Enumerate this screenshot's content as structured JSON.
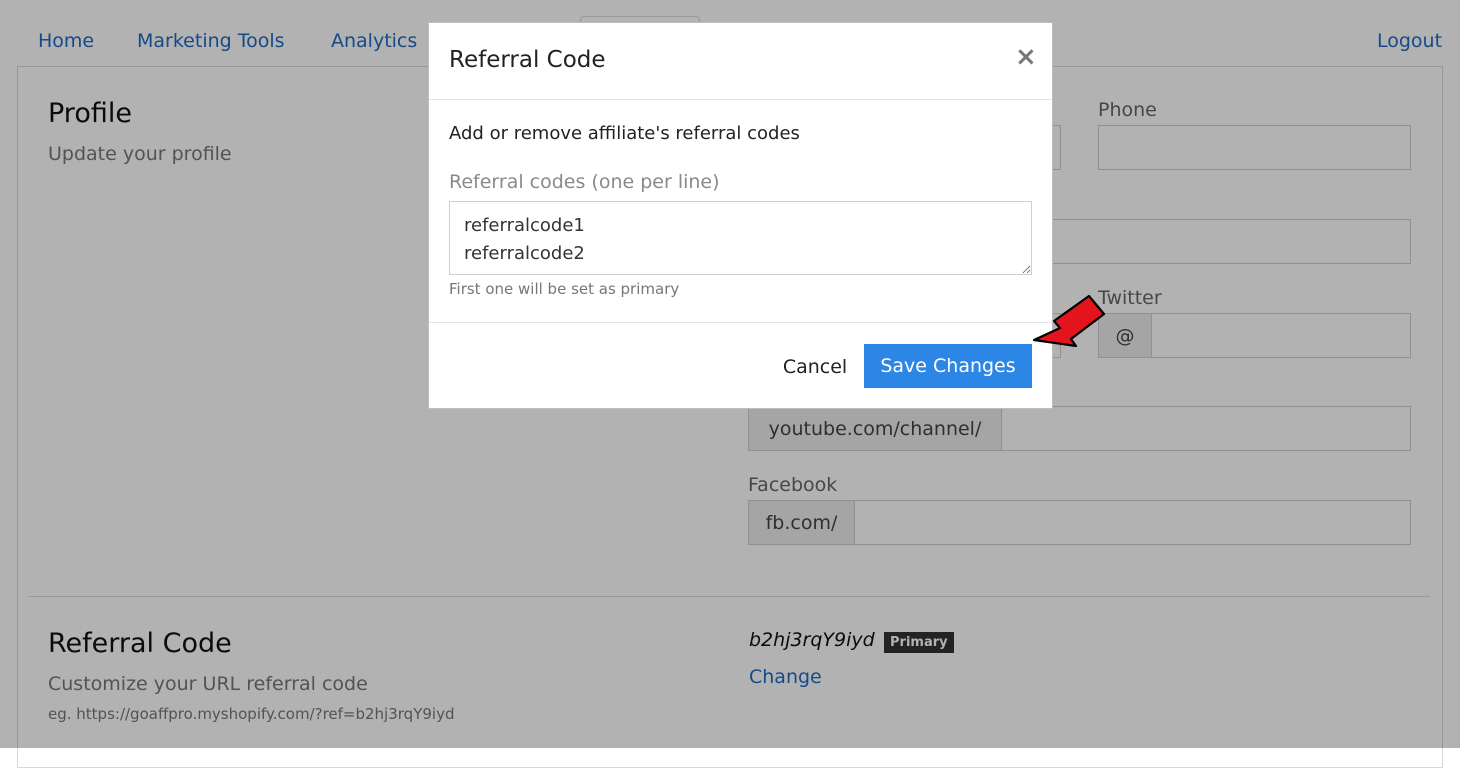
{
  "nav": {
    "items": [
      "Home",
      "Marketing Tools",
      "Analytics"
    ],
    "logout": "Logout"
  },
  "profile": {
    "title": "Profile",
    "subtitle": "Update your profile",
    "phone_label": "Phone",
    "twitter_label": "Twitter",
    "twitter_prefix": "@",
    "youtube_prefix": "youtube.com/channel/",
    "facebook_label": "Facebook",
    "facebook_prefix": "fb.com/"
  },
  "referral_section": {
    "title": "Referral Code",
    "subtitle": "Customize your URL referral code",
    "example": "eg. https://goaffpro.myshopify.com/?ref=b2hj3rqY9iyd",
    "code": "b2hj3rqY9iyd",
    "badge": "Primary",
    "change_link": "Change"
  },
  "modal": {
    "title": "Referral Code",
    "close": "×",
    "description": "Add or remove affiliate's referral codes",
    "codes_label": "Referral codes (one per line)",
    "codes_value": "referralcode1\nreferralcode2",
    "help": "First one will be set as primary",
    "cancel": "Cancel",
    "save": "Save Changes"
  },
  "colors": {
    "accent": "#2b86e6",
    "link": "#1f6bc4",
    "arrow": "#e3141b"
  }
}
